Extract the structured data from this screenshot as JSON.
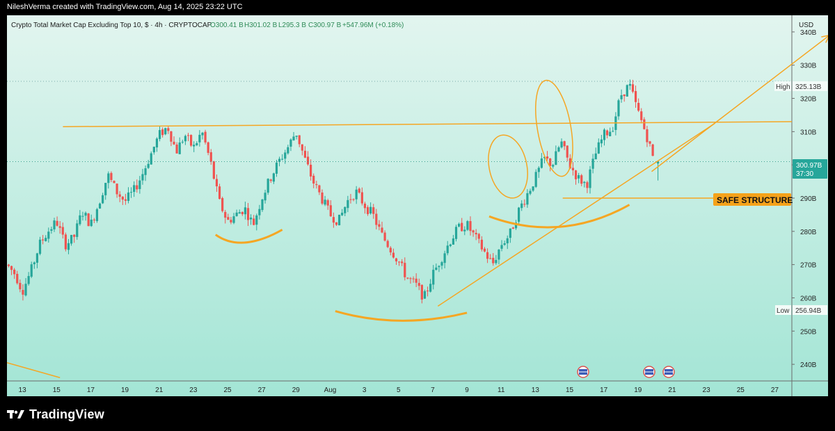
{
  "header": {
    "watermark": "NileshVerma created with TradingView.com, Aug 14, 2025 23:22 UTC"
  },
  "symbol_line": {
    "name": "Crypto Total Market Cap Excluding Top 10, $ · 4h · CRYPTOCAP",
    "open": "O300.41 B",
    "high": "H301.02 B",
    "low": "L295.3 B",
    "close": "C300.97 B",
    "change": "+547.96M (+0.18%)"
  },
  "price_scale": {
    "currency": "USD",
    "ticks": [
      "340B",
      "330B",
      "320B",
      "310B",
      "300B",
      "290B",
      "280B",
      "270B",
      "260B",
      "250B",
      "240B"
    ],
    "high_label": "High",
    "high_value": "325.13B",
    "low_label": "Low",
    "low_value": "256.94B",
    "last_price": "300.97B",
    "countdown": "37:30"
  },
  "annotation": {
    "text": "SAFE STRUCTURE"
  },
  "brand": {
    "name": "TradingView"
  },
  "colors": {
    "bull": "#26A69A",
    "bear": "#EF5350",
    "drawing": "#F5A623",
    "label_bg": "#F5A21A",
    "last_price_bg": "#26A69A",
    "bg_top": "#E2F5EF",
    "bg_bottom": "#A3E5D5"
  },
  "chart_data": {
    "type": "candlestick",
    "timeframe": "4h",
    "y_unit": "B USD",
    "ylim": [
      235,
      345
    ],
    "x_tick_labels": [
      "13",
      "15",
      "17",
      "19",
      "21",
      "23",
      "25",
      "27",
      "29",
      "Aug",
      "3",
      "5",
      "7",
      "9",
      "11",
      "13",
      "15",
      "17",
      "19",
      "21",
      "23",
      "25",
      "27"
    ],
    "x_tick_days": [
      13,
      15,
      17,
      19,
      21,
      23,
      25,
      27,
      29,
      31,
      33,
      35,
      37,
      39,
      41,
      43,
      45,
      47,
      49,
      51,
      53,
      55,
      57
    ],
    "x_range_days": [
      12.1,
      58.0
    ],
    "x_day_note": "July 13 = 13, Aug 1 = 31",
    "key_levels": {
      "resistance_line": [
        [
          17,
          311.5
        ],
        [
          58,
          313.0
        ]
      ],
      "safe_structure": 290.0,
      "period_high": 325.13,
      "period_low": 256.94,
      "last_close": 300.97
    },
    "close_path": [
      [
        12.1,
        270
      ],
      [
        12.6,
        267
      ],
      [
        13,
        262
      ],
      [
        13.5,
        268
      ],
      [
        14,
        276
      ],
      [
        14.5,
        280
      ],
      [
        15,
        283
      ],
      [
        15.5,
        276
      ],
      [
        16,
        278
      ],
      [
        16.5,
        286
      ],
      [
        17,
        282
      ],
      [
        17.5,
        289
      ],
      [
        18,
        297
      ],
      [
        18.5,
        292
      ],
      [
        19,
        289
      ],
      [
        19.5,
        292
      ],
      [
        20,
        297
      ],
      [
        20.5,
        303
      ],
      [
        21,
        309
      ],
      [
        21.5,
        311.5
      ],
      [
        22,
        304
      ],
      [
        22.5,
        309
      ],
      [
        23,
        305
      ],
      [
        23.5,
        310
      ],
      [
        24,
        301
      ],
      [
        24.5,
        289
      ],
      [
        25,
        283
      ],
      [
        25.5,
        285
      ],
      [
        26,
        287
      ],
      [
        26.5,
        282
      ],
      [
        27,
        290
      ],
      [
        27.5,
        296
      ],
      [
        28,
        301
      ],
      [
        28.5,
        305
      ],
      [
        29,
        310
      ],
      [
        29.5,
        302
      ],
      [
        30,
        295
      ],
      [
        30.5,
        290
      ],
      [
        31,
        285
      ],
      [
        31.5,
        283
      ],
      [
        32,
        289
      ],
      [
        32.5,
        292
      ],
      [
        33,
        288
      ],
      [
        33.5,
        285
      ],
      [
        34,
        279
      ],
      [
        34.5,
        275
      ],
      [
        35,
        271
      ],
      [
        35.5,
        266
      ],
      [
        36,
        264
      ],
      [
        36.5,
        260
      ],
      [
        37,
        267
      ],
      [
        37.5,
        272
      ],
      [
        38,
        277
      ],
      [
        38.5,
        281
      ],
      [
        39,
        282
      ],
      [
        39.5,
        278
      ],
      [
        40,
        274
      ],
      [
        40.5,
        270
      ],
      [
        41,
        276
      ],
      [
        41.5,
        279
      ],
      [
        42,
        286
      ],
      [
        42.5,
        291
      ],
      [
        43,
        296
      ],
      [
        43.5,
        302
      ],
      [
        44,
        300
      ],
      [
        44.5,
        307
      ],
      [
        45,
        300
      ],
      [
        45.5,
        296
      ],
      [
        46,
        294
      ],
      [
        46.5,
        303
      ],
      [
        47,
        309
      ],
      [
        47.5,
        311
      ],
      [
        48,
        321
      ],
      [
        48.5,
        324
      ],
      [
        49,
        316
      ],
      [
        49.5,
        309
      ],
      [
        50,
        300
      ]
    ],
    "last_bars": [
      {
        "o": 300.41,
        "h": 301.02,
        "l": 295.3,
        "c": 300.97
      }
    ],
    "drawings": {
      "rising_trendline": [
        [
          37.3,
          257.5
        ],
        [
          53.5,
          312.5
        ]
      ],
      "arrow": [
        [
          49.8,
          298
        ],
        [
          60.2,
          339
        ]
      ],
      "arcs": [
        "under Jul 24–26 low",
        "under Aug 1–5 low",
        "under Aug 11–16 base"
      ],
      "ellipses": [
        "Aug 10–12",
        "Aug 13–15"
      ]
    }
  }
}
